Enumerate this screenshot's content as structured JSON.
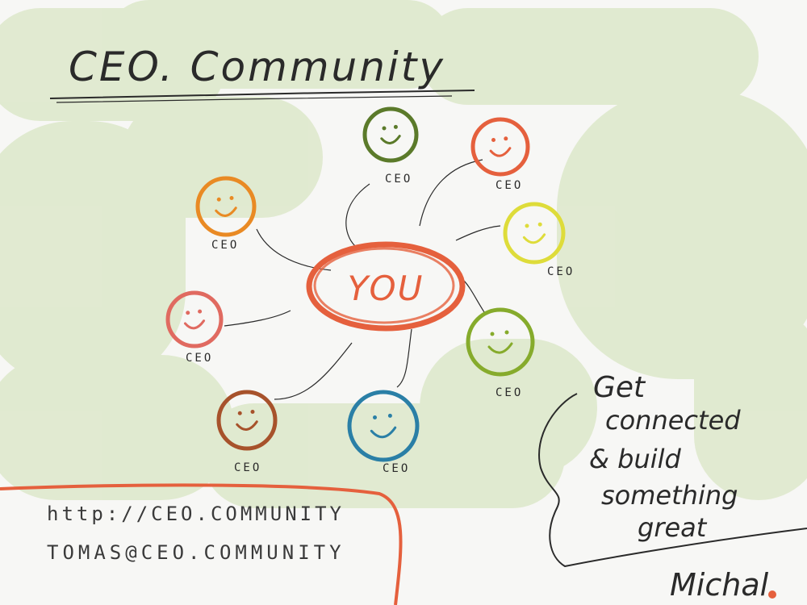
{
  "title": "CEO. Community",
  "center": {
    "label": "YOU",
    "color": "#e5603d"
  },
  "nodes": [
    {
      "id": "orange",
      "label": "CEO",
      "color": "#e98a24"
    },
    {
      "id": "darkgreen",
      "label": "CEO",
      "color": "#5b7a2a"
    },
    {
      "id": "red",
      "label": "CEO",
      "color": "#e5603d"
    },
    {
      "id": "yellow",
      "label": "CEO",
      "color": "#dedc3a"
    },
    {
      "id": "lime",
      "label": "CEO",
      "color": "#86ab2c"
    },
    {
      "id": "blue",
      "label": "CEO",
      "color": "#2a7fa6"
    },
    {
      "id": "brown",
      "label": "CEO",
      "color": "#a7522b"
    },
    {
      "id": "pink",
      "label": "CEO",
      "color": "#e06a60"
    }
  ],
  "contact": {
    "url": "http://CEO.COMMUNITY",
    "email": "TOMAS@CEO.COMMUNITY"
  },
  "slogan": {
    "line1": "Get",
    "line2": "connected",
    "line3": "& build",
    "line4": "something",
    "line5": "great"
  },
  "signature": "Michal",
  "colors": {
    "wash": "#cfe0b2",
    "ink": "#2a2a2a",
    "accent": "#e5603d"
  }
}
